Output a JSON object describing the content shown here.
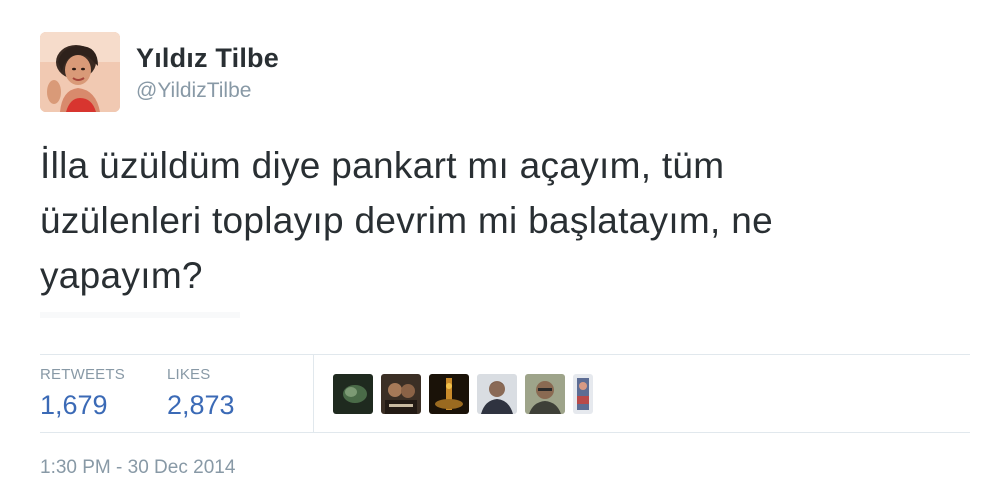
{
  "user": {
    "display_name": "Yıldız Tilbe",
    "screen_name": "@YildizTilbe"
  },
  "tweet": {
    "lines": [
      "İlla üzüldüm diye pankart mı açayım, tüm",
      "üzülenleri toplayıp devrim mi başlatayım, ne",
      "yapayım?"
    ]
  },
  "stats": {
    "retweets_label": "RETWEETS",
    "retweets_count": "1,679",
    "likes_label": "LIKES",
    "likes_count": "2,873"
  },
  "likers": [
    {
      "icon": "liker-avatar-1",
      "color": "#2d3a2a"
    },
    {
      "icon": "liker-avatar-2",
      "color": "#5a4a38"
    },
    {
      "icon": "liker-avatar-3",
      "color": "#6b4a1e"
    },
    {
      "icon": "liker-avatar-4",
      "color": "#3d3f4a"
    },
    {
      "icon": "liker-avatar-5",
      "color": "#7a7c62"
    },
    {
      "icon": "liker-avatar-6",
      "color": "#6a7896"
    }
  ],
  "timestamp": "1:30 PM - 30 Dec 2014",
  "colors": {
    "text": "#292f33",
    "muted": "#8899a6",
    "count": "#3b6ab6",
    "divider": "#e1e8ed"
  }
}
